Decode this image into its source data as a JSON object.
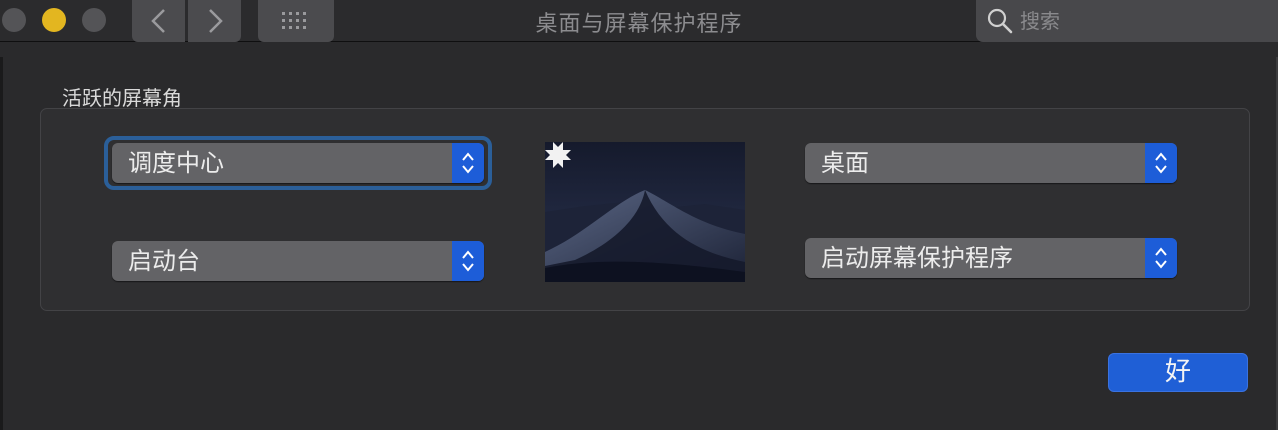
{
  "window": {
    "title": "桌面与屏幕保护程序"
  },
  "search": {
    "placeholder": "搜索",
    "value": ""
  },
  "hot_corners": {
    "group_label": "活跃的屏幕角",
    "top_left": "调度中心",
    "bottom_left": "启动台",
    "top_right": "桌面",
    "bottom_right": "启动屏幕保护程序"
  },
  "footer": {
    "ok_label": "好"
  },
  "colors": {
    "accent": "#1f5fd6",
    "minimize": "#e3b620",
    "background": "#2a2a2c"
  }
}
